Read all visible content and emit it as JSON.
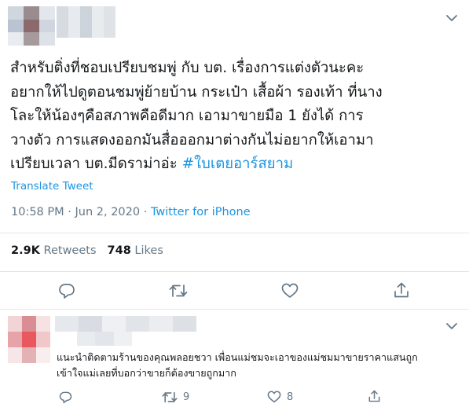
{
  "tweet": {
    "text_lines": [
      "สำหรับติ่งที่ชอบเปรียบชมพู่ กับ บต. เรื่องการแต่งตัวนะคะ",
      "อยากให้ไปดูตอนชมพู่ย้ายบ้าน กระเป๋า เสื้อผ้า รองเท้า ที่นาง",
      "โละให้น้องๆคือสภาพคือดีมาก เอามาขายมือ 1 ยังได้ การ",
      "วางตัว การแสดงออกมันสื่อออกมาต่างกันไม่อยากให้เอามา",
      "เปรียบเวลา บต.มีดราม่าอ่ะ "
    ],
    "hashtag": "#ใบเตยอาร์สยาม",
    "translate_label": "Translate Tweet",
    "time": "10:58 PM",
    "separator": " · ",
    "date": "Jun 2, 2020",
    "source": "Twitter for iPhone",
    "retweets_count": "2.9K",
    "retweets_label": "Retweets",
    "likes_count": "748",
    "likes_label": "Likes",
    "avatar_colors": [
      "#d0d6de",
      "#9a8c8e",
      "#e3e7ec",
      "#b9c3d2",
      "#8a6a6c",
      "#cfd6df",
      "#e8ebef",
      "#a69a9c",
      "#dde2e8"
    ],
    "name_colors": [
      "#d6dbe2",
      "#e7eaee",
      "#cdd3da",
      "#e9ecef",
      "#dfe3e8"
    ]
  },
  "reply": {
    "text_lines": [
      "แนะนำติดตามร้านของคุณพลอยชวา เพื่อนแม่ชมจะเอาของแม่ชมมาขายราคาแสนถูก",
      "เข้าใจแม่เลยที่บอกว่าขายก็ต้องขายถูกมาก"
    ],
    "retweet_count": "9",
    "like_count": "8",
    "avatar_colors": [
      "#f3d4d6",
      "#d98e93",
      "#f6e2e3",
      "#e7a4a8",
      "#e9585f",
      "#f1c7c9",
      "#f7e6e7",
      "#e3b2b5",
      "#f9eeee"
    ],
    "name_colors": [
      "#e5e8ec",
      "#d9dde3",
      "#eef0f3",
      "#e1e5ea",
      "#ebedf0",
      "#dde1e6"
    ],
    "name_colors_2": [
      "#e9ecef",
      "#e2e6eb",
      "#eef0f2"
    ]
  },
  "icons": {
    "caret": "chevron-down-icon",
    "reply": "reply-icon",
    "retweet": "retweet-icon",
    "like": "heart-icon",
    "share": "share-icon"
  },
  "colors": {
    "link": "#1b95e0",
    "secondary_text": "#657786",
    "divider": "#e1e8ed"
  }
}
